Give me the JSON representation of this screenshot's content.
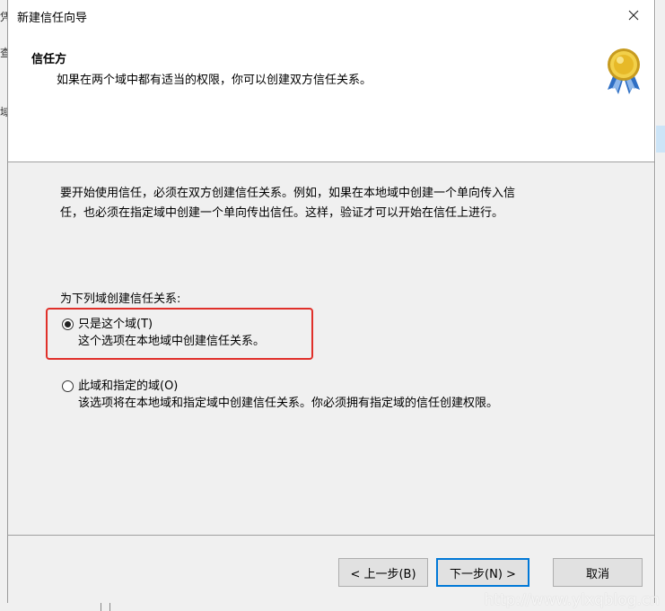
{
  "background": {
    "fragments": [
      "凭",
      "查",
      "域"
    ]
  },
  "dialog": {
    "title": "新建信任向导",
    "close_glyph": "✕",
    "header": {
      "title": "信任方",
      "subtitle": "如果在两个域中都有适当的权限，你可以创建双方信任关系。",
      "icon": "certificate-badge-icon"
    },
    "intro_line1": "要开始使用信任，必须在双方创建信任关系。例如，如果在本地域中创建一个单向传入信",
    "intro_line2": "任，也必须在指定域中创建一个单向传出信任。这样，验证才可以开始在信任上进行。",
    "group_label": "为下列域创建信任关系:",
    "options": [
      {
        "label": "只是这个域(T)",
        "description": "这个选项在本地域中创建信任关系。",
        "checked": true
      },
      {
        "label": "此域和指定的域(O)",
        "description": "该选项将在本地域和指定域中创建信任关系。你必须拥有指定域的信任创建权限。",
        "checked": false
      }
    ],
    "buttons": {
      "back": "< 上一步(B)",
      "next": "下一步(N) >",
      "cancel": "取消"
    }
  },
  "watermark": "http://www.ylxqblog.cn",
  "colors": {
    "highlight": "#e0302a",
    "primary_border": "#0078d7",
    "panel": "#f0f0f0"
  }
}
